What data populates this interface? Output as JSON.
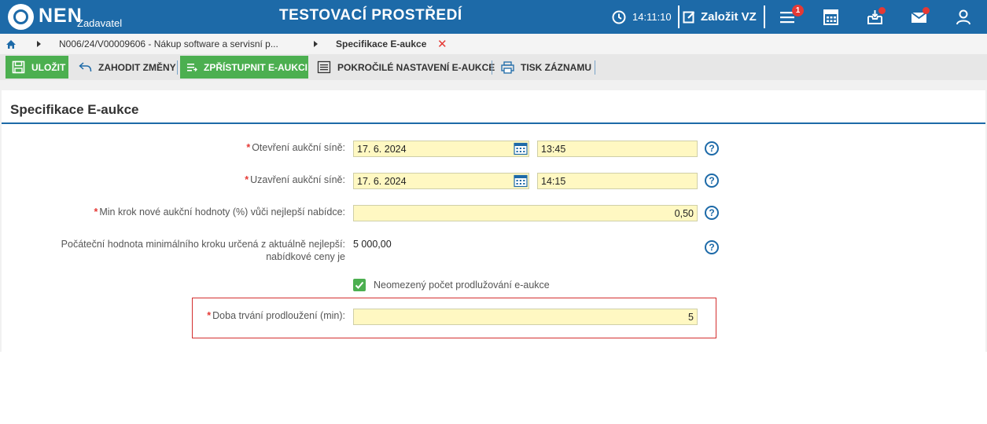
{
  "header": {
    "logo_text": "NEN",
    "logo_sub": "Zadavatel",
    "env_title": "TESTOVACÍ PROSTŘEDÍ",
    "time": "14:11:10",
    "create_label": "Založit VZ",
    "menu_badge": "1",
    "icons": [
      "clock-icon",
      "edit-icon",
      "menu-icon",
      "calculator-icon",
      "inbox-icon",
      "mail-icon",
      "user-icon"
    ]
  },
  "breadcrumb": {
    "path_item": "N006/24/V00009606 - Nákup software a servisní p...",
    "current": "Specifikace E-aukce",
    "close": "✕"
  },
  "toolbar": {
    "save_label": "ULOŽIT",
    "discard_label": "ZAHODIT ZMĚNY",
    "publish_label": "ZPŘÍSTUPNIT E-AUKCI",
    "advanced_label": "POKROČILÉ NASTAVENÍ E-AUKCE",
    "print_label": "TISK ZÁZNAMU"
  },
  "panel": {
    "title": "Specifikace E-aukce"
  },
  "form": {
    "required_mark": "*",
    "open_label": "Otevření aukční síně:",
    "open_date": "17. 6. 2024",
    "open_time": "13:45",
    "close_label": "Uzavření aukční síně:",
    "close_date": "17. 6. 2024",
    "close_time": "14:15",
    "min_step_label": "Min krok nové aukční hodnoty (%) vůči nejlepší nabídce:",
    "min_step_value": "0,50",
    "initial_label": "Počáteční hodnota minimálního kroku určená z aktuálně nejlepší: nabídkové ceny je",
    "initial_value": "5 000,00",
    "unlimited_label": "Neomezený počet prodlužování e-aukce",
    "unlimited_checked": true,
    "extension_label": "Doba trvání prodloužení (min):",
    "extension_value": "5",
    "help_glyph": "?"
  },
  "colors": {
    "header_blue": "#1d6aa8",
    "green": "#4caf50",
    "field_yellow": "#fff8c2",
    "required_red": "#e53935",
    "error_border": "#d32f2f"
  }
}
